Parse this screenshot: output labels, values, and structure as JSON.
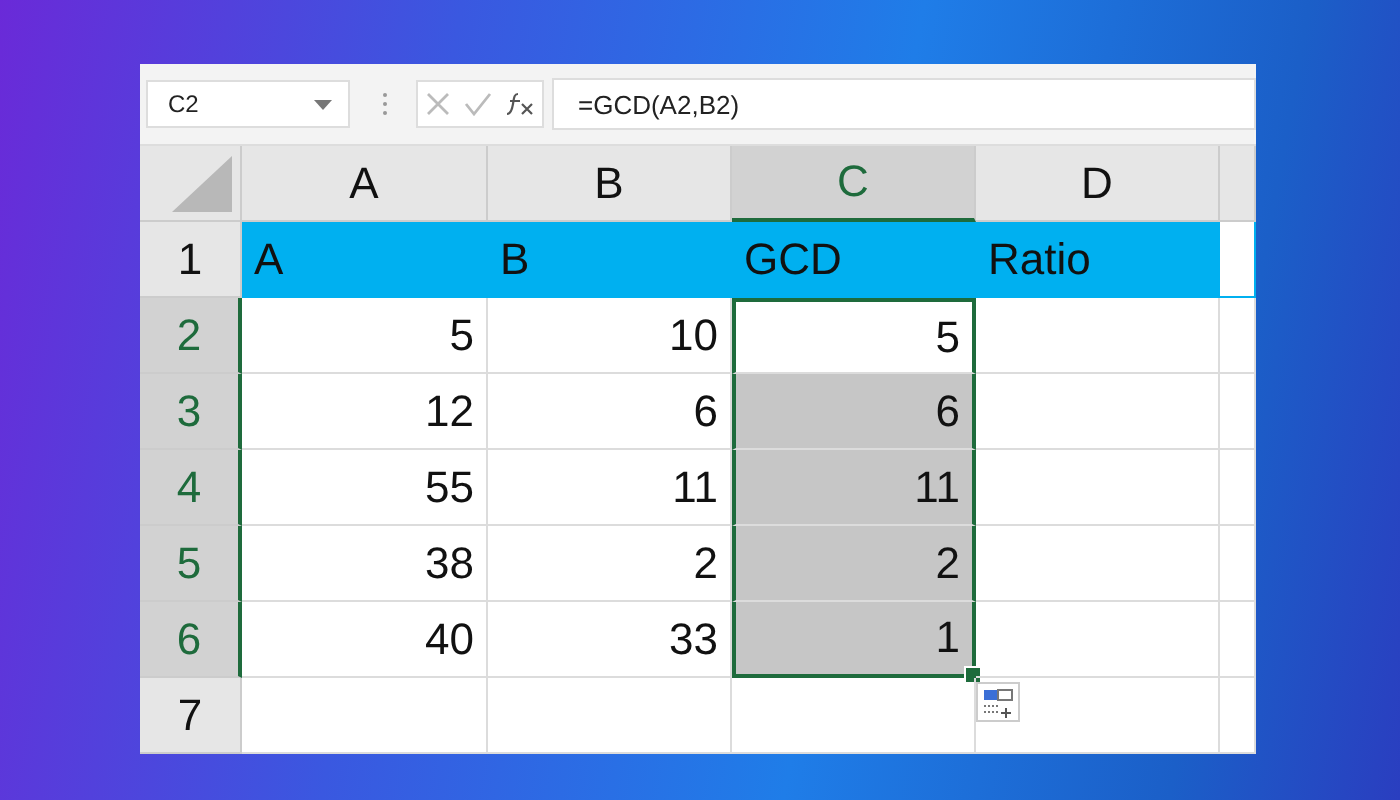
{
  "formula_bar": {
    "name_box": "C2",
    "formula": "=GCD(A2,B2)"
  },
  "columns": [
    {
      "label": "A",
      "selected": false
    },
    {
      "label": "B",
      "selected": false
    },
    {
      "label": "C",
      "selected": true
    },
    {
      "label": "D",
      "selected": false
    }
  ],
  "rows": [
    {
      "label": "1",
      "selected": false,
      "kind": "header",
      "cells": [
        {
          "value": "A",
          "selected": false
        },
        {
          "value": "B",
          "selected": false
        },
        {
          "value": "GCD",
          "selected": false
        },
        {
          "value": "Ratio",
          "selected": false
        }
      ]
    },
    {
      "label": "2",
      "selected": true,
      "kind": "data",
      "cells": [
        {
          "value": "5",
          "selected": false
        },
        {
          "value": "10",
          "selected": false
        },
        {
          "value": "5",
          "selected": true,
          "active": true
        },
        {
          "selected": false
        }
      ]
    },
    {
      "label": "3",
      "selected": true,
      "kind": "data",
      "cells": [
        {
          "value": "12",
          "selected": false
        },
        {
          "value": "6",
          "selected": false
        },
        {
          "value": "6",
          "selected": true,
          "active": false
        },
        {
          "selected": false
        }
      ]
    },
    {
      "label": "4",
      "selected": true,
      "kind": "data",
      "cells": [
        {
          "value": "55",
          "selected": false
        },
        {
          "value": "11",
          "selected": false
        },
        {
          "value": "11",
          "selected": true,
          "active": false
        },
        {
          "selected": false
        }
      ]
    },
    {
      "label": "5",
      "selected": true,
      "kind": "data",
      "cells": [
        {
          "value": "38",
          "selected": false
        },
        {
          "value": "2",
          "selected": false
        },
        {
          "value": "2",
          "selected": true,
          "active": false
        },
        {
          "selected": false
        }
      ]
    },
    {
      "label": "6",
      "selected": true,
      "kind": "data",
      "cells": [
        {
          "value": "40",
          "selected": false
        },
        {
          "value": "33",
          "selected": false
        },
        {
          "value": "1",
          "selected": true,
          "active": false
        },
        {
          "selected": false
        }
      ]
    },
    {
      "label": "7",
      "selected": false,
      "kind": "data",
      "cells": [
        {
          "selected": false
        },
        {
          "selected": false
        },
        {
          "selected": false
        },
        {
          "selected": false
        }
      ]
    }
  ]
}
